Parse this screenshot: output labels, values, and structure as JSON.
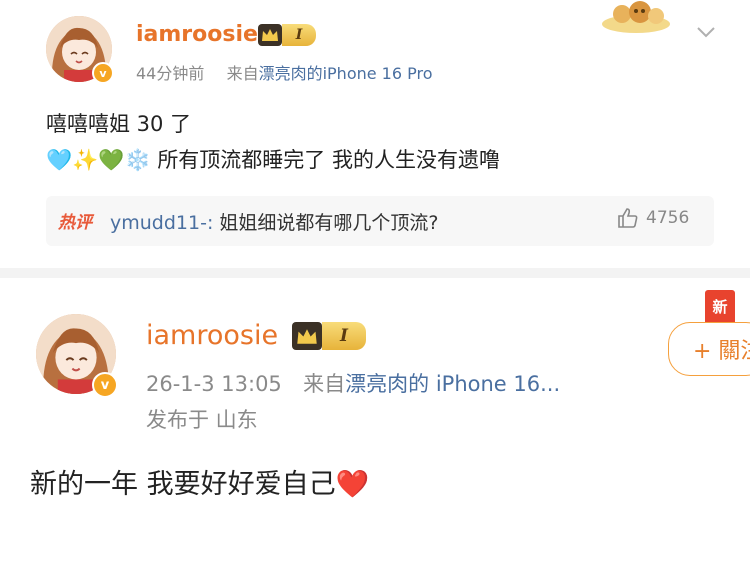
{
  "post1": {
    "username": "iamroosie",
    "level_badge": "I",
    "time": "44分钟前",
    "source_prefix": "来自",
    "source_device": "漂亮肉的iPhone 16 Pro",
    "text_line1": "嘻嘻嘻姐 30 了",
    "emojis": [
      "🩵",
      "✨",
      "💚",
      "❄️"
    ],
    "text_line2": "所有顶流都睡完了 我的人生没有遗噜",
    "hot_comment": {
      "tag": "热评",
      "commenter": "ymudd11-:",
      "text": "姐姐细说都有哪几个顶流?",
      "likes": "4756"
    }
  },
  "post2": {
    "username": "iamroosie",
    "level_badge": "I",
    "date": "26-1-3 13:05",
    "source_prefix": "来自",
    "source_device": "漂亮肉的 iPhone 16...",
    "location": "发布于 山东",
    "text": "新的一年 我要好好爱自己",
    "text_emoji": "❤️",
    "new_tag": "新",
    "follow_label": "+ 關注"
  }
}
